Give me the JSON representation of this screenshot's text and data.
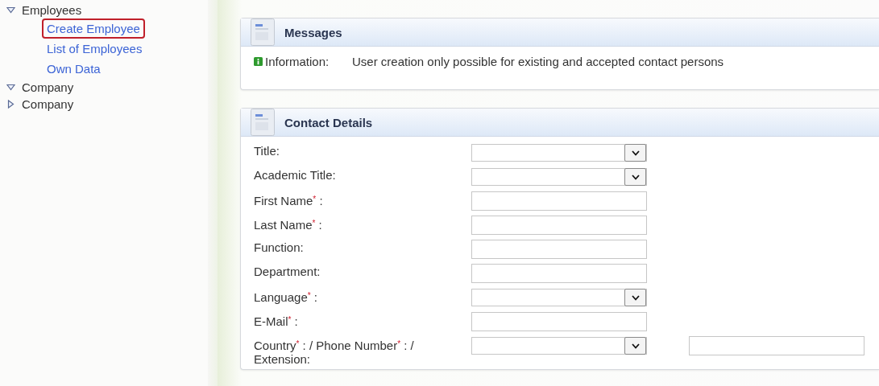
{
  "sidebar": {
    "items": [
      {
        "label": "Employees",
        "expanded": true,
        "children": [
          {
            "label": "Create Employee",
            "selected": true
          },
          {
            "label": "List of Employees",
            "selected": false
          },
          {
            "label": "Own Data",
            "selected": false
          }
        ]
      },
      {
        "label": "Company",
        "expanded": true
      },
      {
        "label": "Company",
        "expanded": false
      }
    ]
  },
  "messages": {
    "title": "Messages",
    "items": [
      {
        "type": "Information:",
        "text": "User creation only possible for existing and accepted contact persons"
      }
    ]
  },
  "contact_details": {
    "title": "Contact Details",
    "rows": [
      {
        "label": "Title:",
        "fields": [
          {
            "kind": "select"
          }
        ]
      },
      {
        "label": "Academic Title:",
        "fields": [
          {
            "kind": "select"
          }
        ]
      },
      {
        "label": "First Name$^{*}$ :",
        "fields": [
          {
            "kind": "text"
          }
        ]
      },
      {
        "label": "Last Name$^{*}$ :",
        "fields": [
          {
            "kind": "text"
          }
        ]
      },
      {
        "label": "Function:",
        "fields": [
          {
            "kind": "text"
          }
        ]
      },
      {
        "label": "Department:",
        "fields": [
          {
            "kind": "text"
          }
        ]
      },
      {
        "label": "Language$^{*}$ :",
        "fields": [
          {
            "kind": "select"
          }
        ]
      },
      {
        "label": "E-Mail$^{*}$ :",
        "fields": [
          {
            "kind": "text"
          }
        ]
      },
      {
        "label": "Country$^{*}$ : / Phone Number$^{*}$ : / Extension:",
        "fields": [
          {
            "kind": "select"
          },
          {
            "kind": "text"
          }
        ]
      }
    ]
  }
}
